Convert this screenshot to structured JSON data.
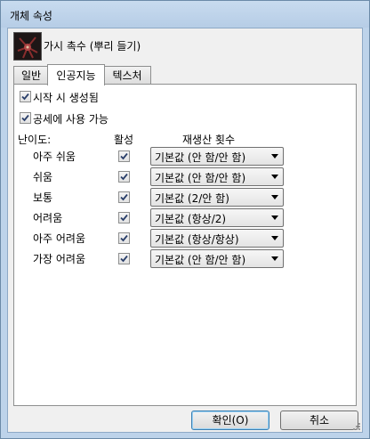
{
  "window": {
    "title": "개체 속성"
  },
  "header": {
    "object_name": "가시 촉수 (뿌리 들기)",
    "icon": "creature-thumbnail-icon"
  },
  "tabs": [
    {
      "label": "일반",
      "active": false
    },
    {
      "label": "인공지능",
      "active": true
    },
    {
      "label": "텍스처",
      "active": false
    }
  ],
  "options": {
    "spawn_on_start": {
      "label": "시작 시 생성됨",
      "checked": true
    },
    "attack_usable": {
      "label": "공세에 사용 가능",
      "checked": true
    }
  },
  "table": {
    "col_difficulty": "난이도:",
    "col_active": "활성",
    "col_respawn": "재생산 횟수",
    "rows": [
      {
        "difficulty": "아주 쉬움",
        "active": true,
        "respawn": "기본값 (안 함/안 함)"
      },
      {
        "difficulty": "쉬움",
        "active": true,
        "respawn": "기본값 (안 함/안 함)"
      },
      {
        "difficulty": "보통",
        "active": true,
        "respawn": "기본값 (2/안 함)"
      },
      {
        "difficulty": "어려움",
        "active": true,
        "respawn": "기본값 (항상/2)"
      },
      {
        "difficulty": "아주 어려움",
        "active": true,
        "respawn": "기본값 (항상/항상)"
      },
      {
        "difficulty": "가장 어려움",
        "active": true,
        "respawn": "기본값 (안 함/안 함)"
      }
    ]
  },
  "buttons": {
    "ok": "확인(O)",
    "cancel": "취소"
  }
}
